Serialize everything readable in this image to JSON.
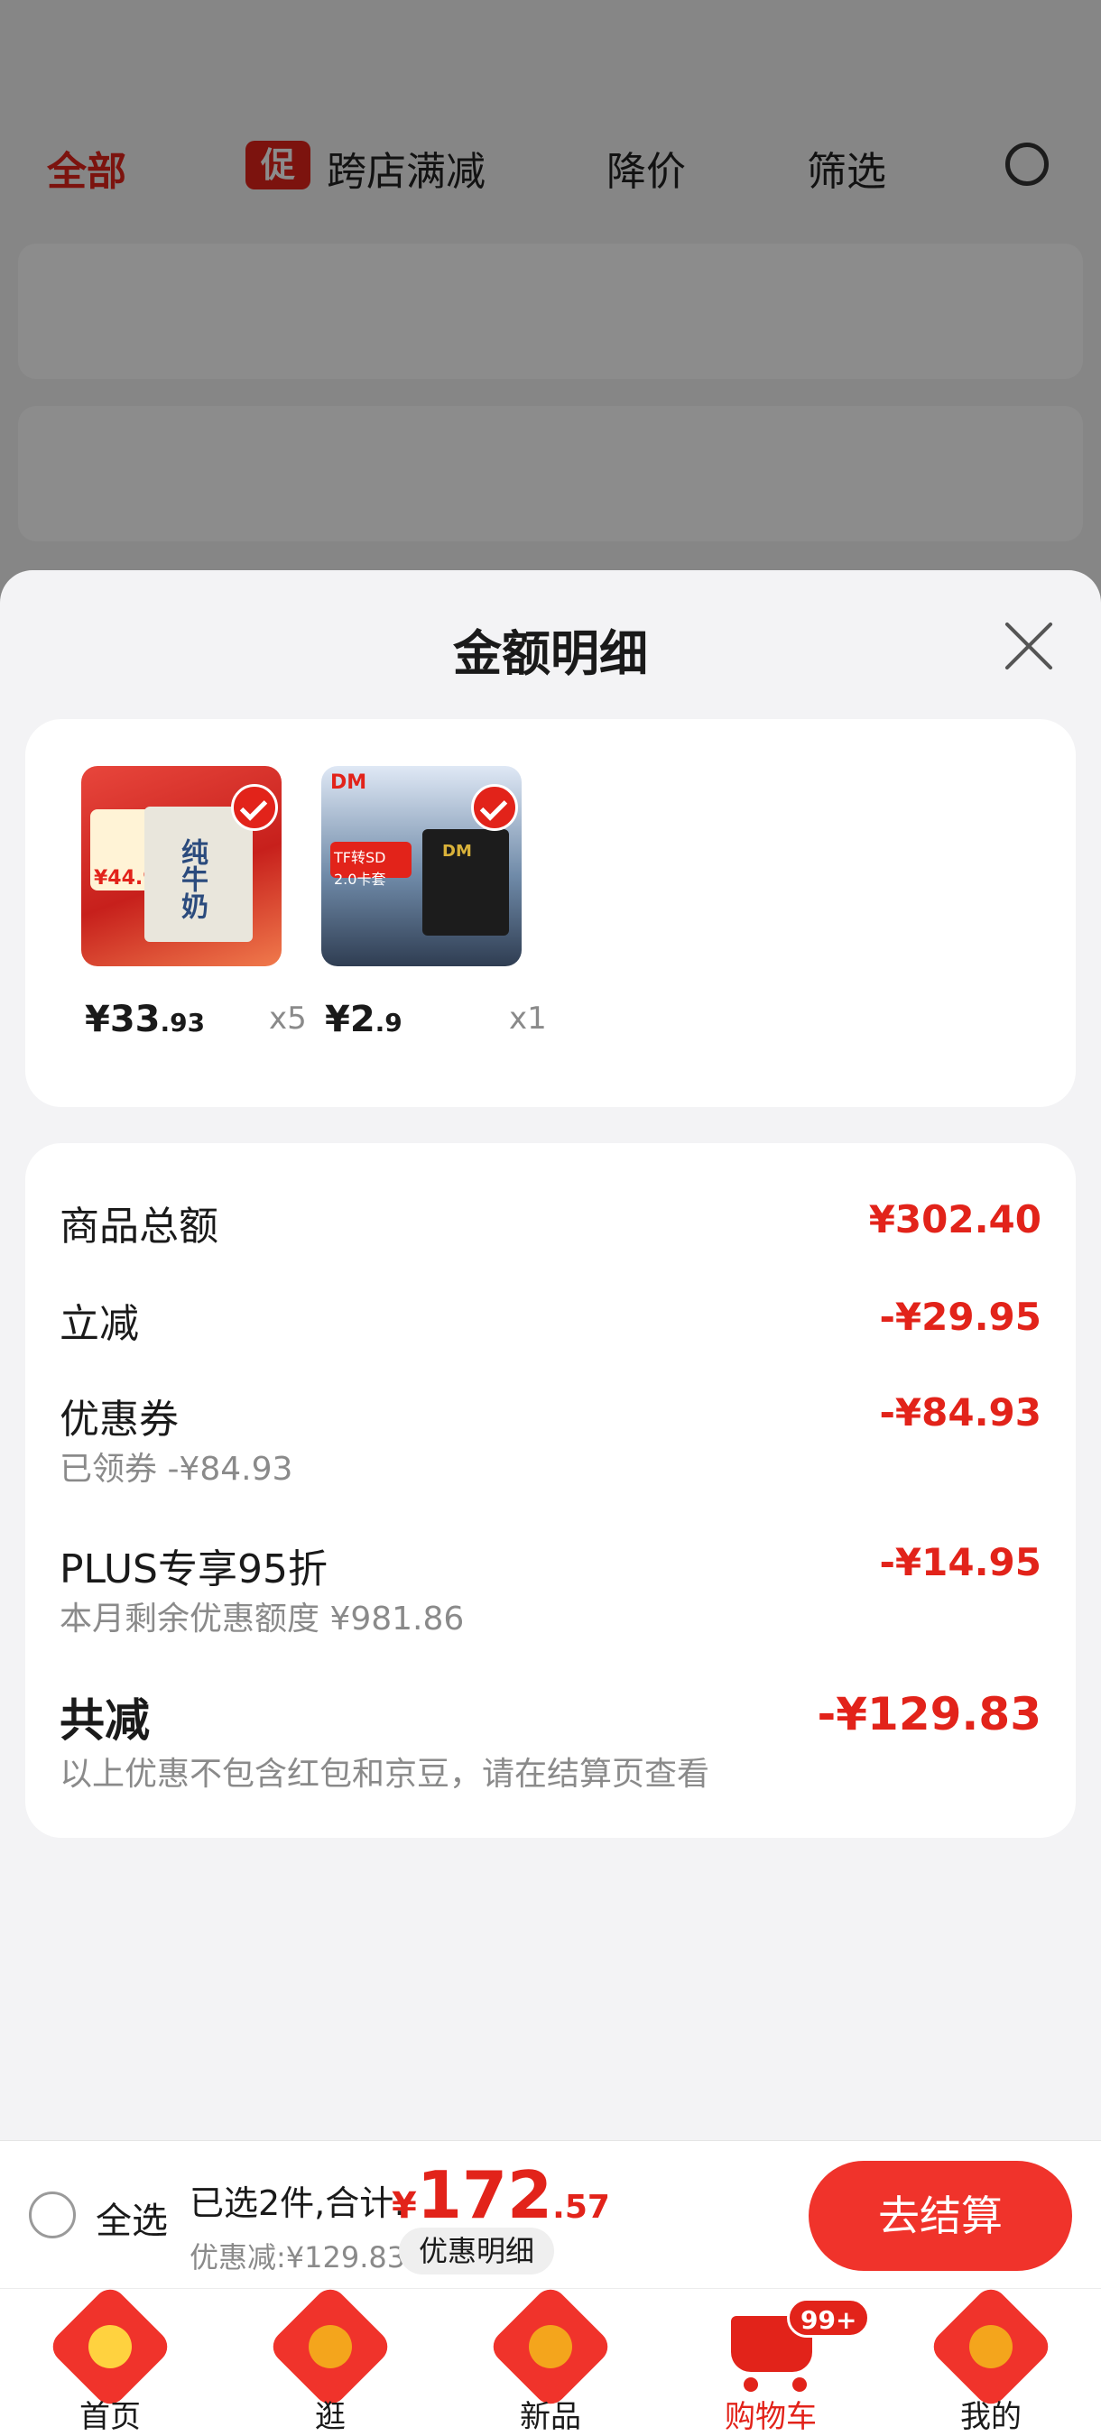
{
  "background_page": {
    "filters": [
      "全部",
      "促",
      "跨店满减",
      "降价",
      "筛选"
    ]
  },
  "sheet": {
    "title": "金额明细",
    "close_label": "×"
  },
  "items": [
    {
      "name": "纯牛奶",
      "thumb_text": "纯牛奶",
      "tag_price": "¥44.9",
      "price_int": "¥33",
      "price_dec": ".93",
      "qty": "x5",
      "selected": true
    },
    {
      "name": "DM TF转SD卡套",
      "thumb_text": "DM",
      "thumb_sub": "TF转SD 2.0卡套",
      "price_int": "¥2",
      "price_dec": ".9",
      "qty": "x1",
      "selected": true
    }
  ],
  "detail": {
    "goods_total_label": "商品总额",
    "goods_total": "¥302.40",
    "instant_label": "立减",
    "instant": "-¥29.95",
    "coupon_label": "优惠券",
    "coupon_sub": "已领券 -¥84.93",
    "coupon": "-¥84.93",
    "plus_label": "PLUS专享95折",
    "plus_sub": "本月剩余优惠额度 ¥981.86",
    "plus": "-¥14.95",
    "total_label": "共减",
    "total_sub": "以上优惠不包含红包和京豆，请在结算页查看",
    "total": "-¥129.83"
  },
  "checkout": {
    "select_all": "全选",
    "summary": "已选2件,合计:",
    "yen": "¥",
    "amount_int": "172",
    "amount_dec": ".57",
    "discount": "优惠减:¥129.83",
    "detail_btn": "优惠明细",
    "checkout_btn": "去结算"
  },
  "tabs": [
    {
      "label": "首页",
      "color": "#f4a51c"
    },
    {
      "label": "逛",
      "color": "#f4a51c"
    },
    {
      "label": "新品",
      "color": "#f0332b"
    },
    {
      "label": "购物车",
      "badge": "99+",
      "active": true
    },
    {
      "label": "我的",
      "color": "#f0332b"
    }
  ],
  "colors": {
    "accent": "#e2231a",
    "button": "#f0332b"
  }
}
